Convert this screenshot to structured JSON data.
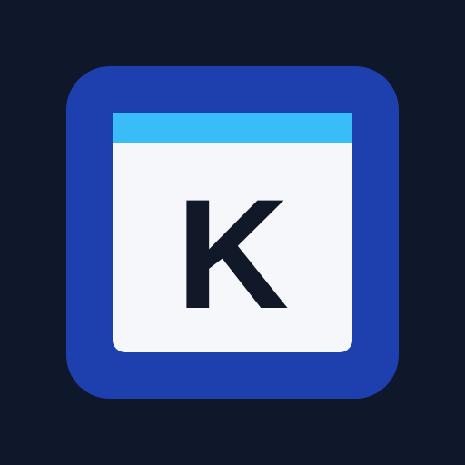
{
  "app_icon": {
    "letter": "K",
    "colors": {
      "background": "#0f172a",
      "tile": "#1e40af",
      "titlebar": "#38bdf8",
      "window": "#f5f7fb",
      "letter": "#111827"
    }
  }
}
